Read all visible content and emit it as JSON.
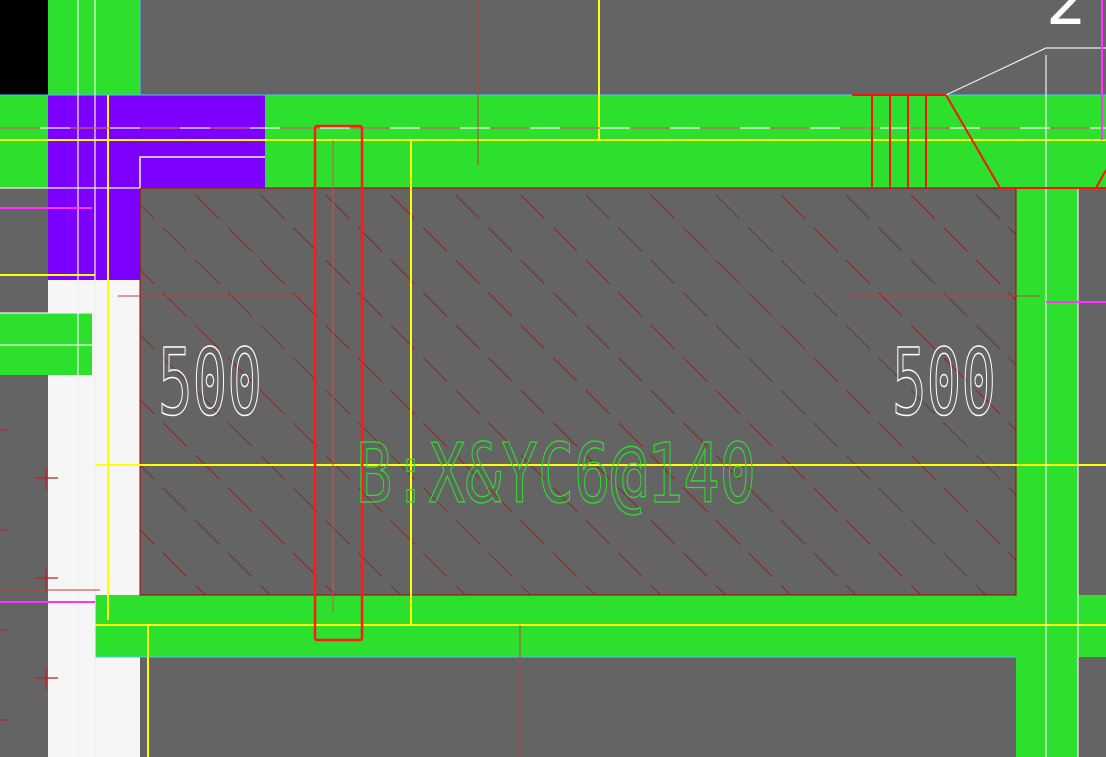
{
  "drawing": {
    "dim_left": "500",
    "dim_right": "500",
    "rebar_label": "B:X&YC6@140",
    "corner_label": "2"
  },
  "colors": {
    "background": "#646464",
    "wall": "#2ee02e",
    "column": "#7d00ff",
    "axis": "#ffff00",
    "rebar": "#ff0000",
    "dimension_text": "#ffffff",
    "annotation_text": "#2ee02e",
    "magenta": "#ff33ff",
    "hatch": "#b00000"
  }
}
